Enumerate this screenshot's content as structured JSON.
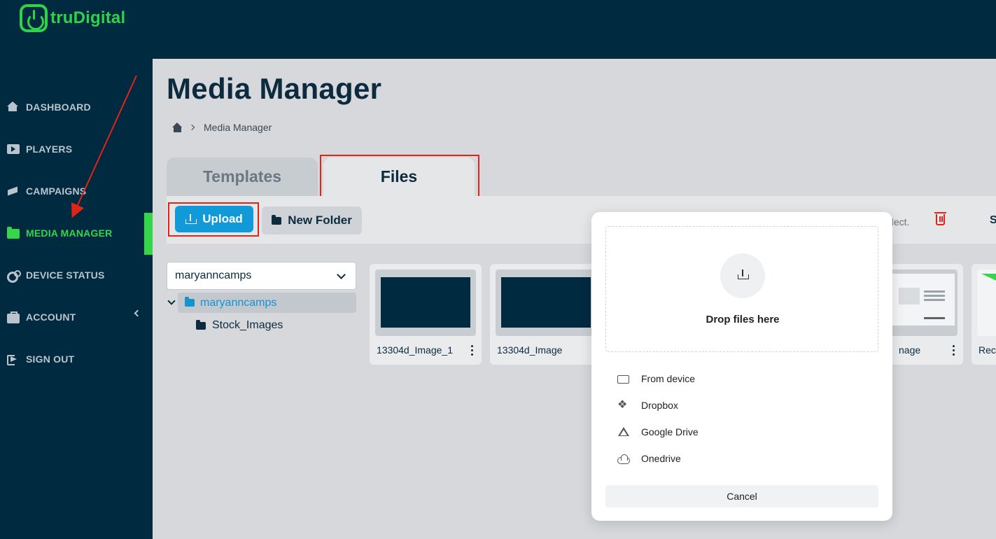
{
  "brand": {
    "name": "truDigital",
    "color": "#2fd34a"
  },
  "sidebar": {
    "items": [
      {
        "label": "DASHBOARD",
        "icon": "home-icon"
      },
      {
        "label": "PLAYERS",
        "icon": "play-icon"
      },
      {
        "label": "CAMPAIGNS",
        "icon": "megaphone-icon"
      },
      {
        "label": "MEDIA MANAGER",
        "icon": "folder-icon",
        "active": true
      },
      {
        "label": "DEVICE STATUS",
        "icon": "gears-icon"
      },
      {
        "label": "ACCOUNT",
        "icon": "briefcase-icon"
      },
      {
        "label": "SIGN OUT",
        "icon": "sign-out-icon"
      }
    ]
  },
  "page": {
    "title": "Media Manager",
    "breadcrumb": "Media Manager"
  },
  "tabs": {
    "templates": "Templates",
    "files": "Files"
  },
  "toolbar": {
    "upload_label": "Upload",
    "new_folder_label": "New Folder",
    "select_hint": "elect.",
    "overflow_text": "S"
  },
  "folders": {
    "selected": "maryanncamps",
    "root": "maryanncamps",
    "children": [
      "Stock_Images"
    ]
  },
  "media": [
    {
      "name": "13304d_Image_1"
    },
    {
      "name": "13304d_Image"
    },
    {
      "name": "nage"
    },
    {
      "name": "Rec"
    }
  ],
  "upload_modal": {
    "drop_text": "Drop files here",
    "sources": [
      "From device",
      "Dropbox",
      "Google Drive",
      "Onedrive"
    ],
    "cancel_label": "Cancel"
  },
  "colors": {
    "nav_bg": "#002a40",
    "accent_green": "#35d649",
    "upload_blue": "#1299d8",
    "annotation_red": "#e02418"
  }
}
